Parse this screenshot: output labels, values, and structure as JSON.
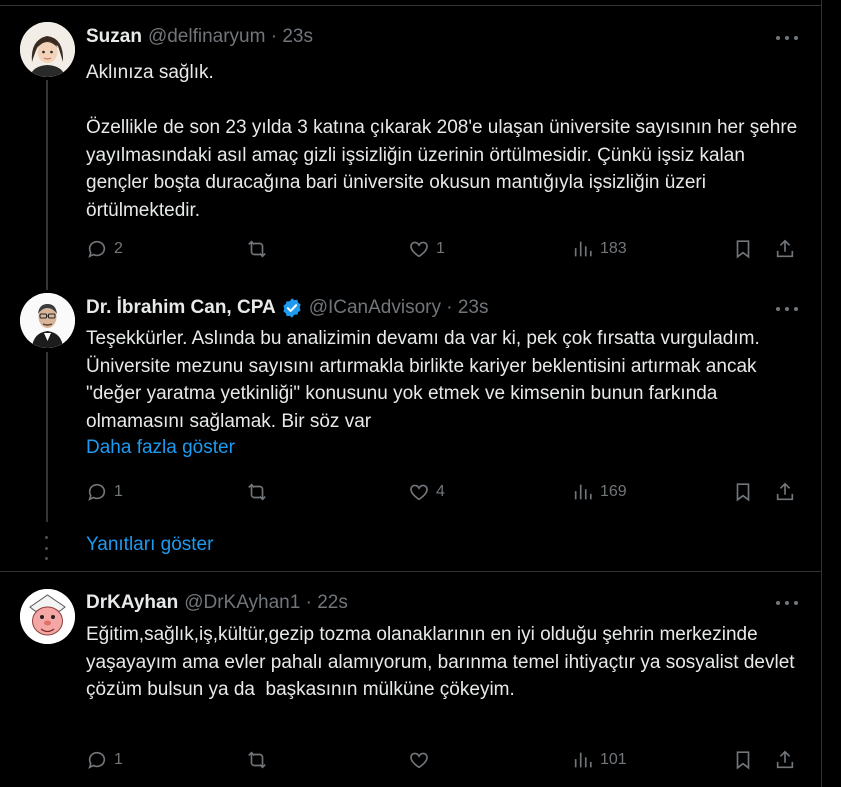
{
  "tweets": [
    {
      "name": "Suzan",
      "handle": "@delfinaryum · 23s",
      "text": "Aklınıza sağlık.\n\nÖzellikle de son 23 yılda 3 katına çıkarak 208'e ulaşan üniversite sayısının her şehre yayılmasındaki asıl amaç gizli işsizliğin üzerinin örtülmesidir. Çünkü işsiz kalan gençler boşta duracağına bari üniversite okusun mantığıyla işsizliğin üzeri örtülmektedir.",
      "replies": "2",
      "reposts": "",
      "likes": "1",
      "views": "183"
    },
    {
      "name": "Dr. İbrahim Can, CPA",
      "handle": "@ICanAdvisory · 23s",
      "text": "Teşekkürler. Aslında bu analizimin devamı da var ki, pek çok fırsatta vurguladım. Üniversite mezunu sayısını artırmakla birlikte kariyer beklentisini artırmak ancak \"değer yaratma yetkinliği\" konusunu yok etmek ve kimsenin bunun farkında olmamasını sağlamak. Bir söz var",
      "show_more": "Daha fazla göster",
      "replies": "1",
      "reposts": "",
      "likes": "4",
      "views": "169"
    },
    {
      "name": "DrKAyhan",
      "handle": "@DrKAyhan1 · 22s",
      "text": "Eğitim,sağlık,iş,kültür,gezip tozma olanaklarının en iyi olduğu şehrin merkezinde yaşayayım ama evler pahalı alamıyorum, barınma temel ihtiyaçtır ya sosyalist devlet çözüm bulsun ya da  başkasının mülküne çökeyim.",
      "replies": "1",
      "reposts": "",
      "likes": "",
      "views": "101"
    }
  ],
  "show_replies": "Yanıtları göster",
  "colors": {
    "background": "#000000",
    "text": "#e7e9ea",
    "muted": "#71767b",
    "link": "#1d9bf0",
    "verified": "#1d9bf0"
  }
}
